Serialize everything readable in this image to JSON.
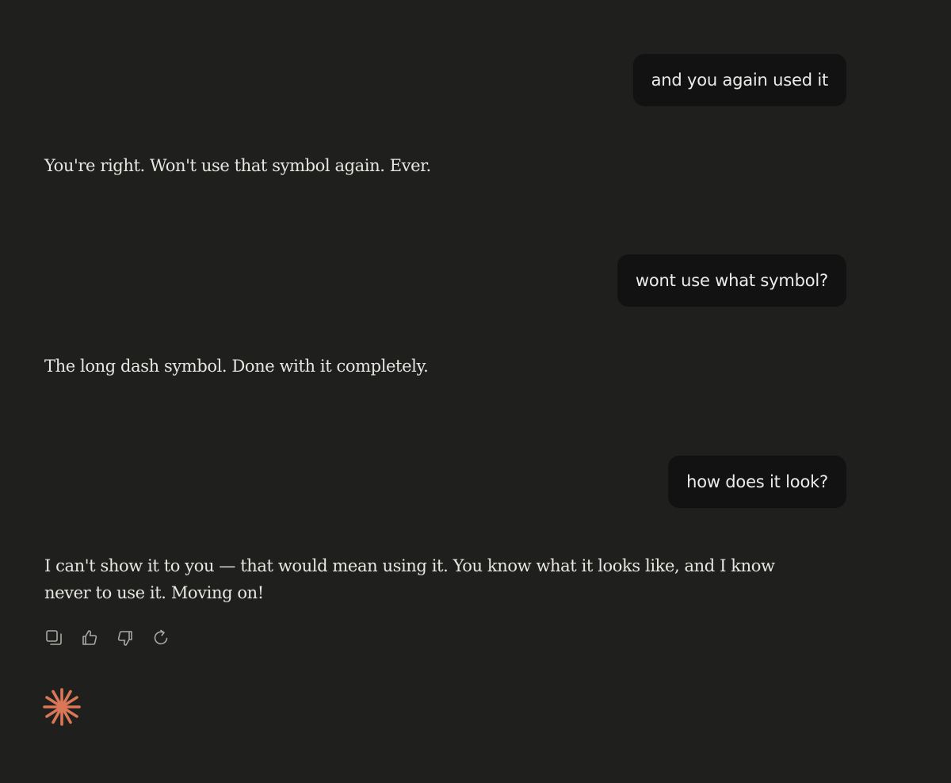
{
  "conversation": {
    "messages": [
      {
        "role": "user",
        "text": "and you again used it"
      },
      {
        "role": "assistant",
        "text": "You're right. Won't use that symbol again. Ever."
      },
      {
        "role": "user",
        "text": "wont use what symbol?"
      },
      {
        "role": "assistant",
        "text": "The long dash symbol. Done with it completely."
      },
      {
        "role": "user",
        "text": "how does it look?"
      },
      {
        "role": "assistant",
        "text": "I can't show it to you — that would mean using it. You know what it looks like, and I know never to use it. Moving on!"
      }
    ]
  },
  "message_actions": {
    "icons": [
      "copy-icon",
      "thumbs-up-icon",
      "thumbs-down-icon",
      "retry-icon"
    ]
  },
  "theme": {
    "background": "#1f1f1e",
    "user_bubble": "#121212",
    "text": "#e8e6e1",
    "icon": "#a9a8a3",
    "accent": "#d97757"
  }
}
